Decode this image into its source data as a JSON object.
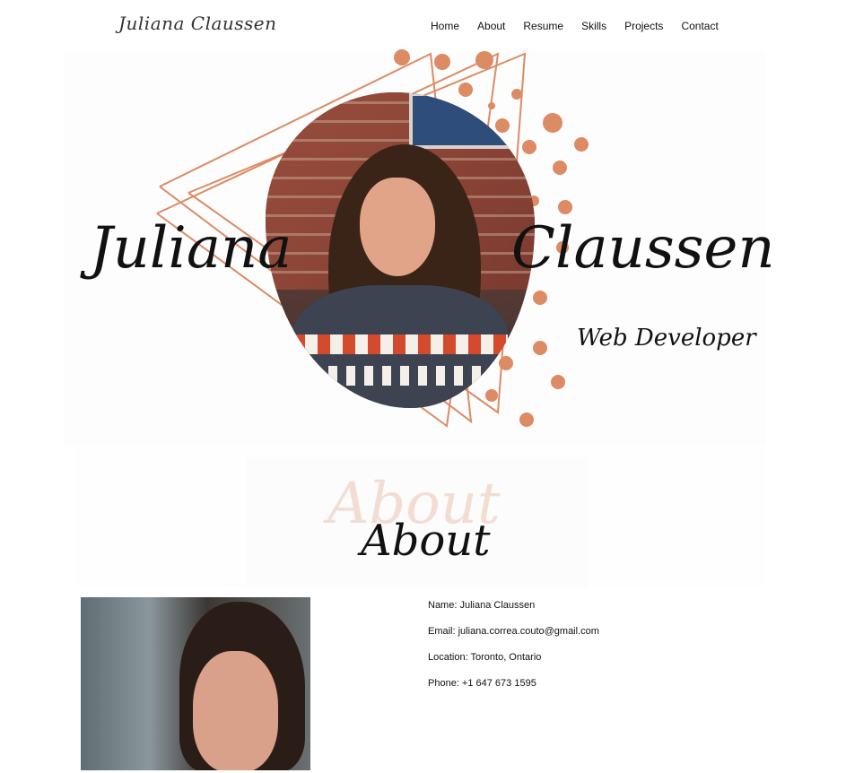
{
  "header": {
    "logo": "Juliana Claussen",
    "nav": [
      "Home",
      "About",
      "Resume",
      "Skills",
      "Projects",
      "Contact"
    ]
  },
  "hero": {
    "first_name": "Juliana",
    "last_name": "Claussen",
    "role": "Web Developer",
    "accent_color": "#dc8b64"
  },
  "about": {
    "ghost_title": "About",
    "title": "About",
    "info": [
      "Name: Juliana Claussen",
      "Email: juliana.correa.couto@gmail.com",
      "Location: Toronto, Ontario",
      "Phone: +1 647 673 1595"
    ]
  }
}
